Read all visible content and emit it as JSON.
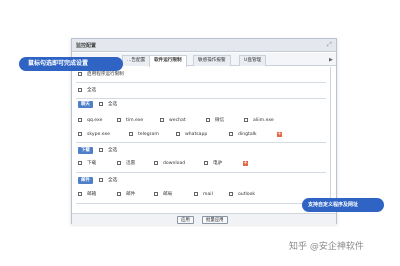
{
  "window": {
    "title": "监控配置"
  },
  "tabs": [
    {
      "label": "...告配置",
      "active": false
    },
    {
      "label": "软件运行限制",
      "active": true
    },
    {
      "label": "敏感操作报警",
      "active": false
    },
    {
      "label": "U盘管理",
      "active": false
    }
  ],
  "content": {
    "enable_label": "启用程序运行限制",
    "select_all_top": "全选",
    "categories": [
      {
        "name": "聊天",
        "select_all": "全选",
        "rows": [
          [
            "qq.exe",
            "tim.exe",
            "wechat",
            "微信",
            "aliim.exe"
          ],
          [
            "skype.exe",
            "telegram",
            "whatsapp",
            "dingtalk"
          ]
        ]
      },
      {
        "name": "下载",
        "select_all": "全选",
        "rows": [
          [
            "下载",
            "迅雷",
            "download",
            "电驴"
          ]
        ]
      },
      {
        "name": "邮件",
        "select_all": "全选",
        "rows": [
          [
            "邮箱",
            "邮件",
            "邮局",
            "mail",
            "outlook"
          ]
        ]
      }
    ]
  },
  "buttons": {
    "apply": "应用",
    "batch_apply": "批量应用"
  },
  "callouts": {
    "left": "鼠标勾选即可完成设置",
    "right": "支持自定义程序及网址"
  },
  "watermark": "知乎 @安企神软件",
  "colors": {
    "callout": "#2f64c5",
    "category_badge": "#4f7fc7",
    "add_icon": "#e06a4a"
  }
}
